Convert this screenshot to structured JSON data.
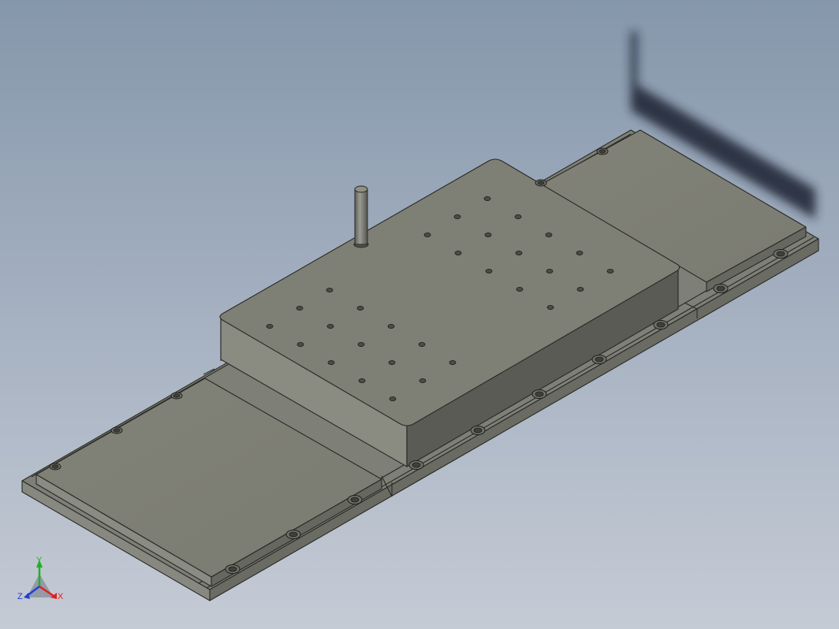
{
  "view": {
    "type": "cad-3d-viewport",
    "background_top": "#8597ab",
    "background_bottom": "#c5cbd5",
    "part_color": "#7e7f76",
    "edge_color": "#2a2a26"
  },
  "triad": {
    "x_label": "X",
    "y_label": "Y",
    "z_label": "Z",
    "x_color": "#e02020",
    "y_color": "#22b022",
    "z_color": "#2040d0"
  }
}
